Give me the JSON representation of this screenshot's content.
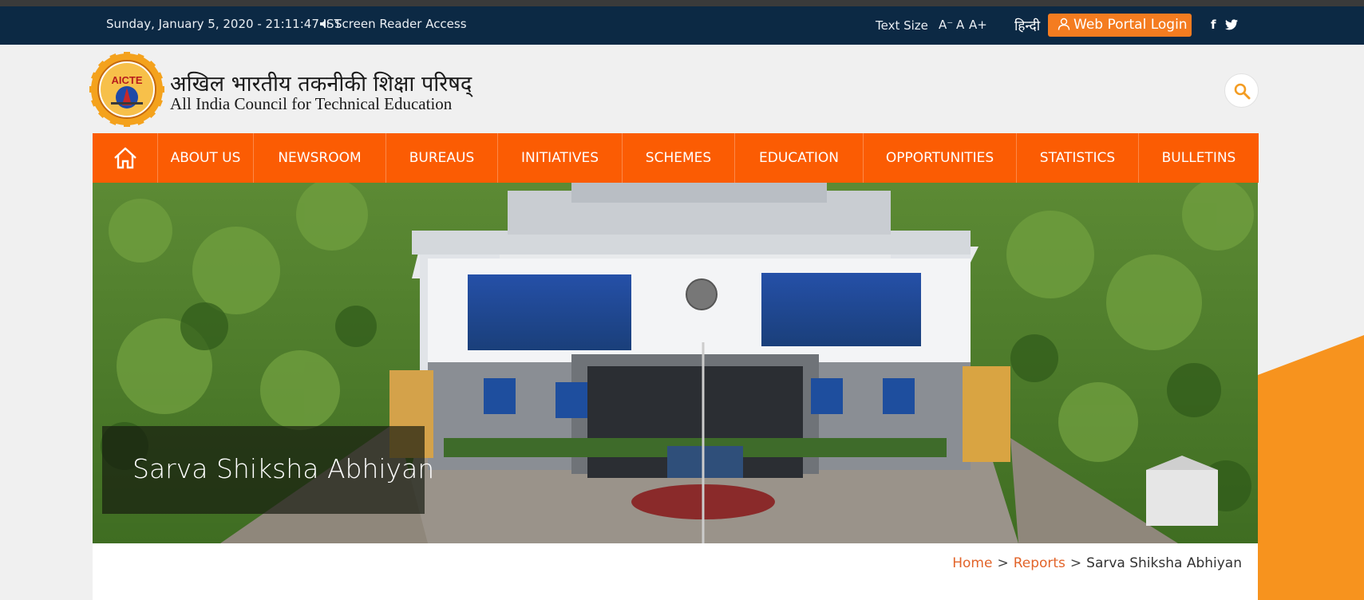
{
  "topbar": {
    "datetime": "Sunday, January 5, 2020 - 21:11:47 IST",
    "screen_reader": "Screen Reader Access",
    "text_size_label": "Text Size",
    "text_size_decrease": "A⁻",
    "text_size_normal": "A",
    "text_size_increase": "A+",
    "hindi_link": "हिन्दी",
    "login_label": "Web Portal Login",
    "social": [
      "f",
      "𝕥"
    ]
  },
  "header": {
    "seal_text": "AICTE",
    "title_hindi": "अखिल भारतीय तकनीकी शिक्षा परिषद्",
    "title_english": "All India Council for Technical Education"
  },
  "nav": {
    "items": [
      "ABOUT US",
      "NEWSROOM",
      "BUREAUS",
      "INITIATIVES",
      "SCHEMES",
      "EDUCATION",
      "OPPORTUNITIES",
      "STATISTICS",
      "BULLETINS"
    ]
  },
  "hero": {
    "caption": "Sarva Shiksha Abhiyan"
  },
  "breadcrumb": {
    "home": "Home",
    "reports": "Reports",
    "current": "Sarva Shiksha Abhiyan",
    "separator": ">"
  },
  "colors": {
    "topbar_bg": "#0c2944",
    "nav_bg": "#fb5c03",
    "login_bg": "#f47c20",
    "accent": "#f7931e"
  }
}
